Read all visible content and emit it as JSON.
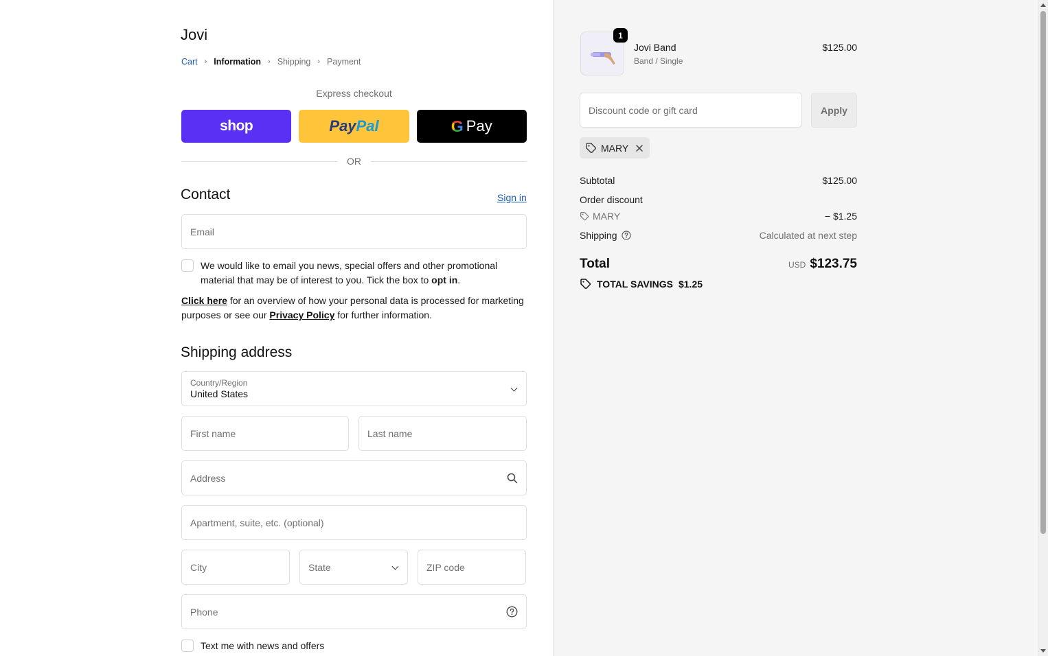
{
  "store": {
    "name": "Jovi"
  },
  "breadcrumb": {
    "items": [
      "Cart",
      "Information",
      "Shipping",
      "Payment"
    ],
    "separator": "›"
  },
  "express": {
    "label": "Express checkout",
    "shop_label": "shop",
    "paypal_label_1": "Pay",
    "paypal_label_2": "Pal",
    "gpay_g": "G",
    "gpay_label": "Pay",
    "or_label": "OR"
  },
  "contact": {
    "title": "Contact",
    "sign_in": "Sign in",
    "email_placeholder": "Email",
    "optin_text_1": "We would like to email you news, special offers and other promotional material that may be of interest to you. Tick the box to ",
    "optin_bold": "opt in",
    "optin_end": ".",
    "privacy_link_1": "Click here",
    "privacy_text_1": " for an overview of how your personal data is processed for marketing purposes or see our ",
    "privacy_link_2": "Privacy Policy",
    "privacy_text_2": " for further information."
  },
  "shipping": {
    "title": "Shipping address",
    "country_label": "Country/Region",
    "country_value": "United States",
    "first_name": "First name",
    "last_name": "Last name",
    "address": "Address",
    "apartment": "Apartment, suite, etc. (optional)",
    "city": "City",
    "state": "State",
    "zip": "ZIP code",
    "phone": "Phone",
    "text_optin": "Text me with news and offers"
  },
  "order": {
    "quantity": "1",
    "product_name": "Jovi Band",
    "product_variant": "Band / Single",
    "product_price": "$125.00",
    "discount_placeholder": "Discount code or gift card",
    "apply_label": "Apply",
    "applied_code": "MARY",
    "subtotal_label": "Subtotal",
    "subtotal_value": "$125.00",
    "order_discount_label": "Order discount",
    "discount_code": "MARY",
    "discount_value": "− $1.25",
    "shipping_label": "Shipping",
    "shipping_value": "Calculated at next step",
    "total_label": "Total",
    "currency": "USD",
    "total_value": "$123.75",
    "savings_label": "TOTAL SAVINGS",
    "savings_value": "$1.25"
  },
  "colors": {
    "shop": "#5a31f4",
    "paypal": "#ffc439",
    "gpay": "#000000",
    "link": "#1a5bb4",
    "summary_bg": "#f5f5f5"
  }
}
